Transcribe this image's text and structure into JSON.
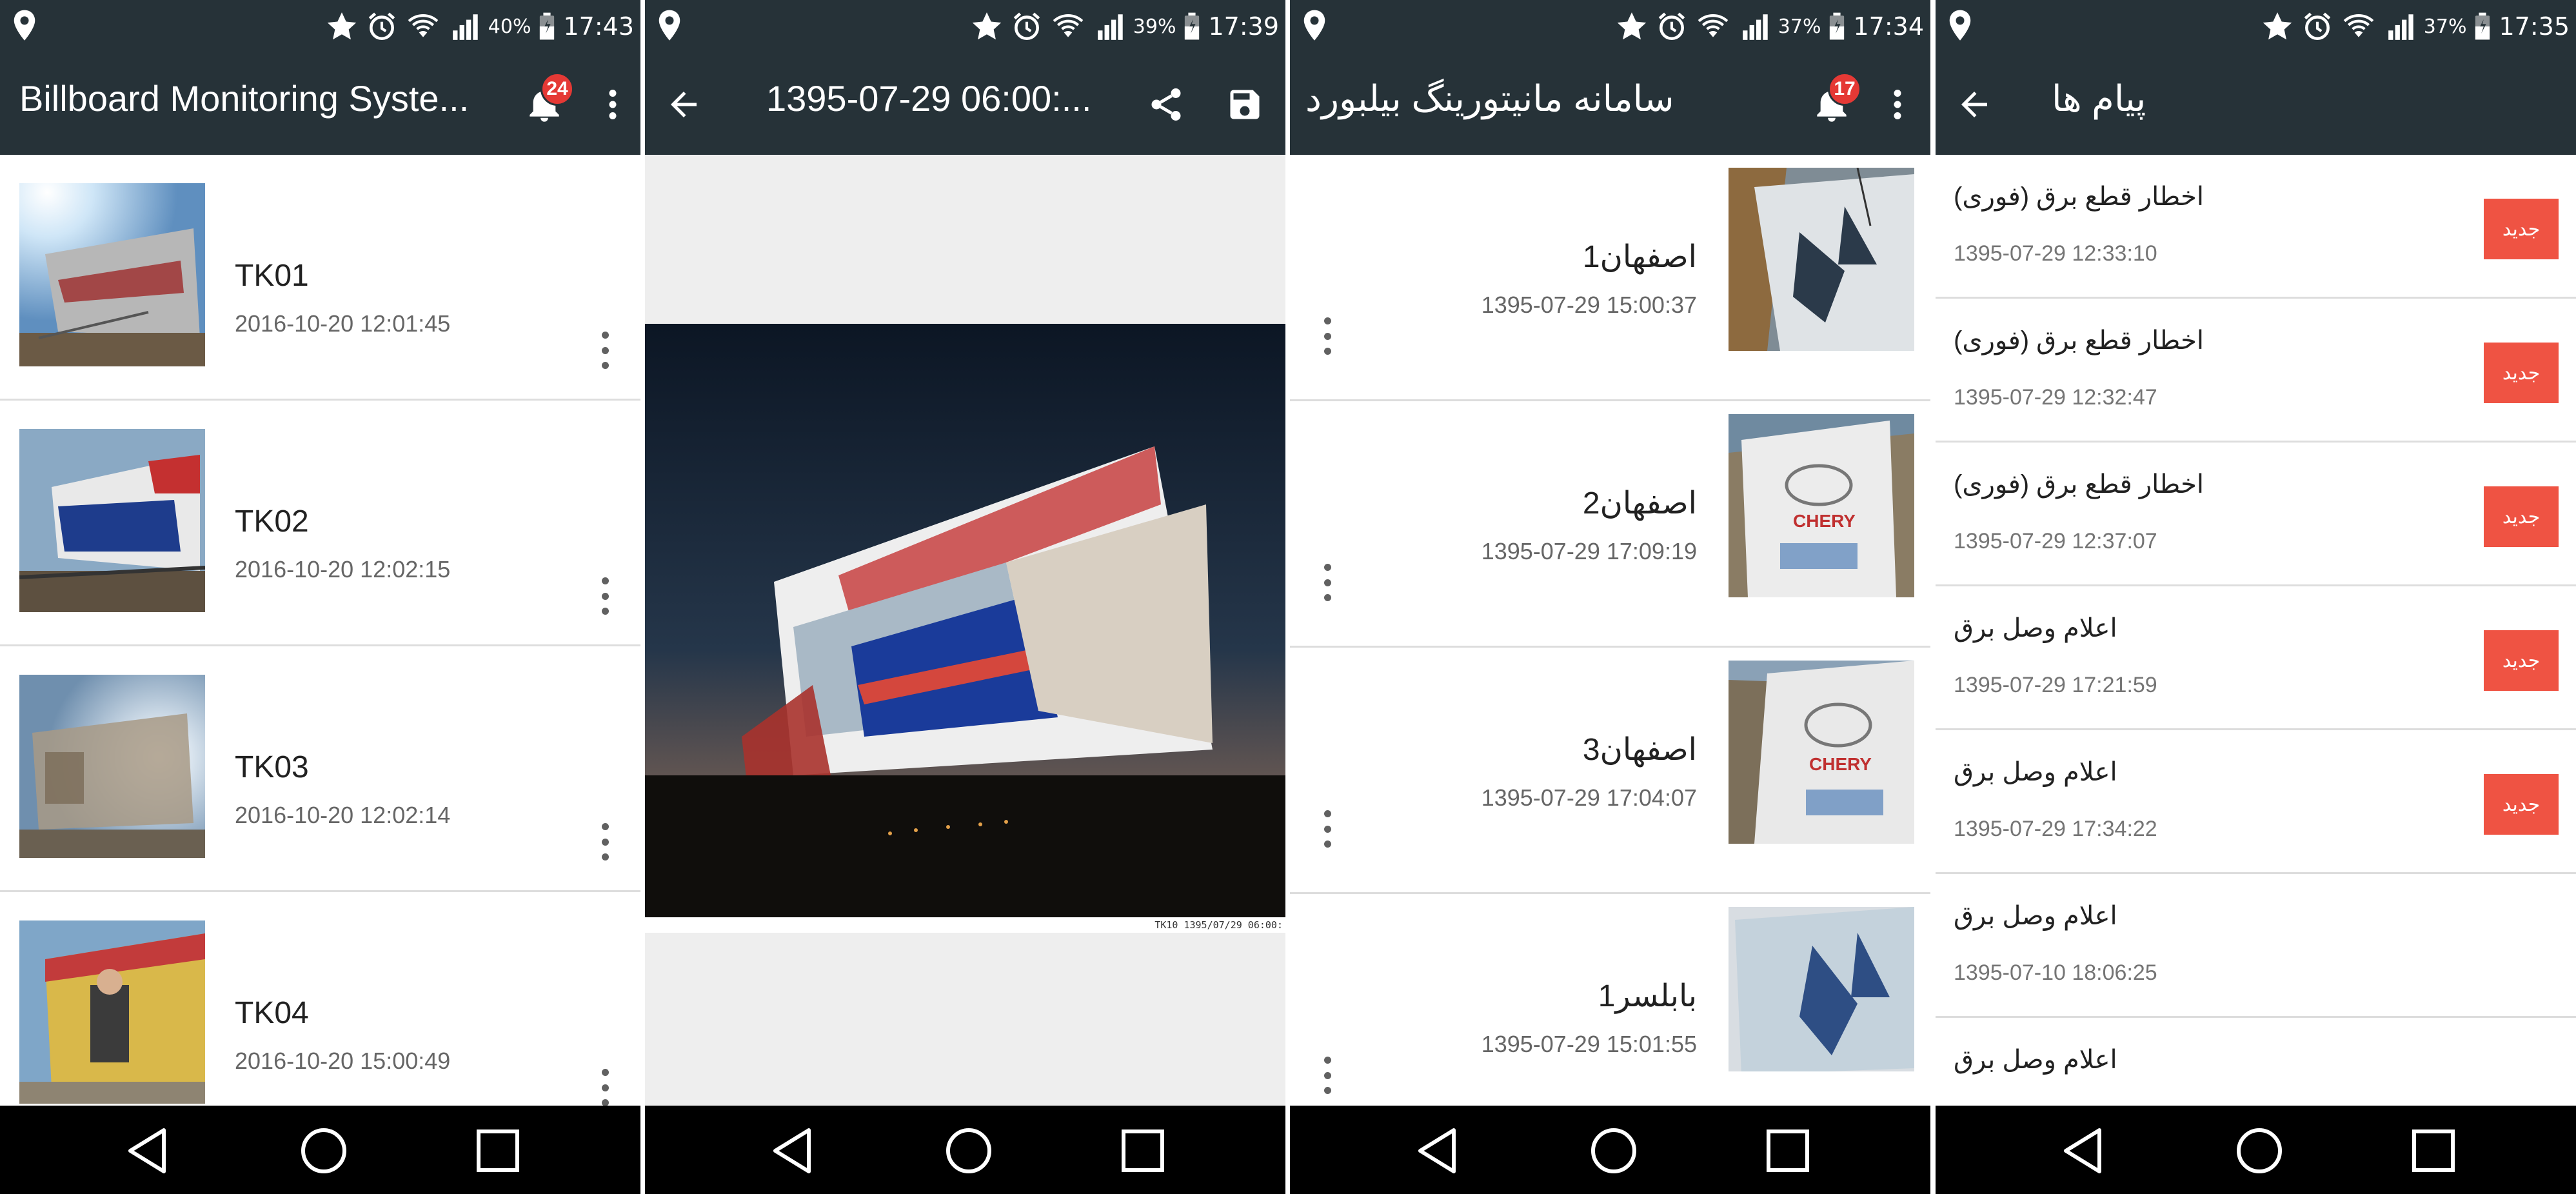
{
  "colors": {
    "appbar": "#263238",
    "badge": "#e53935",
    "new_button": "#ef5343",
    "navbar": "#000000",
    "viewer_bg": "#eeeeee"
  },
  "panel1": {
    "status": {
      "battery": "40%",
      "time": "17:43"
    },
    "title": "Billboard Monitoring Syste...",
    "notification_count": "24",
    "items": [
      {
        "name": "TK01",
        "time": "2016-10-20 12:01:45"
      },
      {
        "name": "TK02",
        "time": "2016-10-20 12:02:15"
      },
      {
        "name": "TK03",
        "time": "2016-10-20 12:02:14"
      },
      {
        "name": "TK04",
        "time": "2016-10-20 15:00:49"
      }
    ]
  },
  "panel2": {
    "status": {
      "battery": "39%",
      "time": "17:39"
    },
    "title": "1395-07-29 06:00:...",
    "image_stamp": "TK10    1395/07/29    06:00:"
  },
  "panel3": {
    "status": {
      "battery": "37%",
      "time": "17:34"
    },
    "title": "سامانه مانیتورینگ بیلبورد",
    "notification_count": "17",
    "items": [
      {
        "name": "اصفهان1",
        "time": "1395-07-29 15:00:37"
      },
      {
        "name": "اصفهان2",
        "time": "1395-07-29 17:09:19"
      },
      {
        "name": "اصفهان3",
        "time": "1395-07-29 17:04:07"
      },
      {
        "name": "بابلسر1",
        "time": "1395-07-29 15:01:55"
      }
    ]
  },
  "panel4": {
    "status": {
      "battery": "37%",
      "time": "17:35"
    },
    "title": "پیام ها",
    "new_label": "جدید",
    "messages": [
      {
        "text": "اخطار قطع برق (فوری)",
        "time": "1395-07-29 12:33:10",
        "is_new": true
      },
      {
        "text": "اخطار قطع برق (فوری)",
        "time": "1395-07-29 12:32:47",
        "is_new": true
      },
      {
        "text": "اخطار قطع برق (فوری)",
        "time": "1395-07-29 12:37:07",
        "is_new": true
      },
      {
        "text": "اعلام وصل برق",
        "time": "1395-07-29 17:21:59",
        "is_new": true
      },
      {
        "text": "اعلام وصل برق",
        "time": "1395-07-29 17:34:22",
        "is_new": true
      },
      {
        "text": "اعلام وصل برق",
        "time": "1395-07-10 18:06:25",
        "is_new": false
      },
      {
        "text": "اعلام وصل برق",
        "time": "",
        "is_new": false
      }
    ]
  }
}
